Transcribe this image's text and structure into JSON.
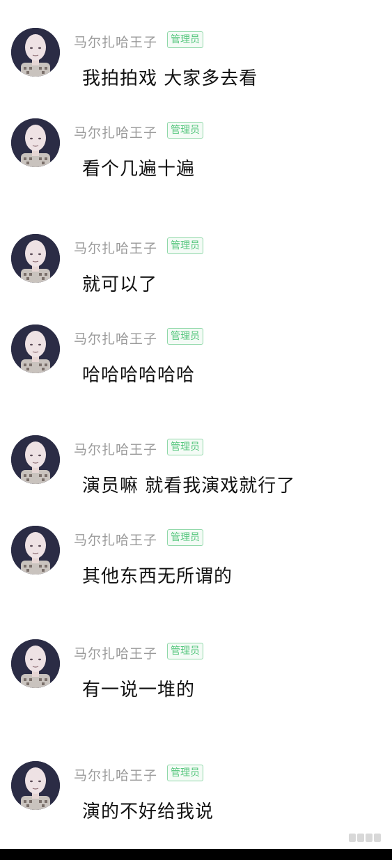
{
  "messages": [
    {
      "name": "马尔扎哈王子",
      "badge": "管理员",
      "text": "我拍拍戏 大家多去看"
    },
    {
      "name": "马尔扎哈王子",
      "badge": "管理员",
      "text": "看个几遍十遍"
    },
    {
      "name": "马尔扎哈王子",
      "badge": "管理员",
      "text": "就可以了"
    },
    {
      "name": "马尔扎哈王子",
      "badge": "管理员",
      "text": "哈哈哈哈哈哈"
    },
    {
      "name": "马尔扎哈王子",
      "badge": "管理员",
      "text": "演员嘛 就看我演戏就行了"
    },
    {
      "name": "马尔扎哈王子",
      "badge": "管理员",
      "text": "其他东西无所谓的"
    },
    {
      "name": "马尔扎哈王子",
      "badge": "管理员",
      "text": "有一说一堆的"
    },
    {
      "name": "马尔扎哈王子",
      "badge": "管理员",
      "text": "演的不好给我说"
    }
  ],
  "colors": {
    "name": "#9a9a9a",
    "badge": "#52c57b",
    "text": "#111111",
    "avatar_bg": "#2b2c45"
  },
  "icons": {
    "avatar": "bald-cartoon-character-avatar",
    "watermark": "weibo-watermark-logo"
  }
}
